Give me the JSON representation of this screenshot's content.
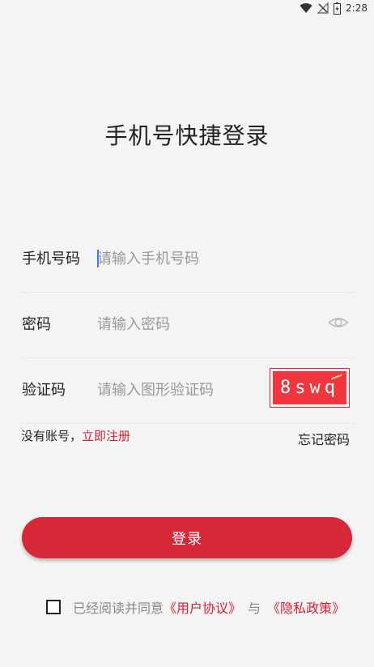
{
  "status_bar": {
    "time": "2:28",
    "icons": [
      "wifi-icon",
      "no-signal-icon",
      "battery-icon"
    ]
  },
  "title": "手机号快捷登录",
  "form": {
    "phone": {
      "label": "手机号码",
      "placeholder": "请输入手机号码",
      "value": ""
    },
    "password": {
      "label": "密码",
      "placeholder": "请输入密码",
      "value": "",
      "toggle_icon": "eye-icon"
    },
    "captcha": {
      "label": "验证码",
      "placeholder": "请输入图形验证码",
      "value": "",
      "image_text": "8swq"
    }
  },
  "links": {
    "no_account": "没有账号，",
    "register": "立即注册",
    "forgot_password": "忘记密码"
  },
  "login_button": "登录",
  "agreement": {
    "checked": false,
    "prefix": "已经阅读并同意",
    "user_agreement": "《用户协议》",
    "and": "与",
    "privacy_policy": "《隐私政策》"
  },
  "colors": {
    "accent": "#d7283a",
    "background": "#f4f4f4",
    "captcha_bg": "#f0373f"
  }
}
